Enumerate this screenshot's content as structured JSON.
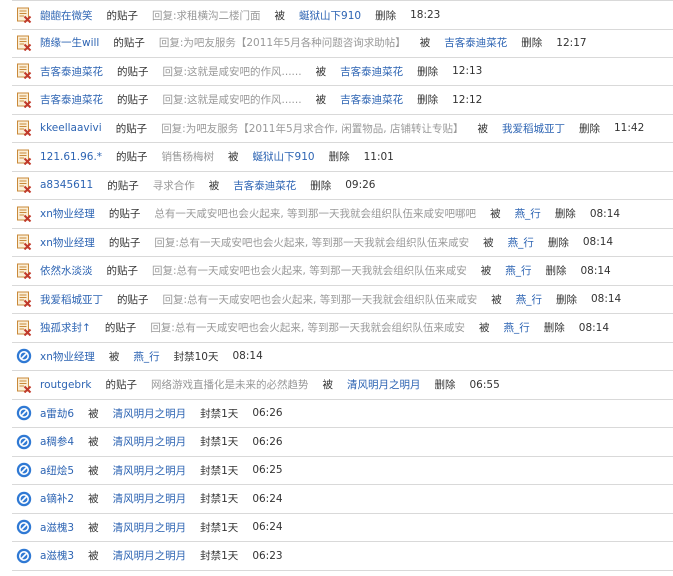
{
  "logs": [
    {
      "type": "post",
      "user": "龅龅在微笑",
      "label": "的贴子",
      "content": "回复:求租横沟二楼门面",
      "by": "被",
      "operator": "蜒狱山下910",
      "action": "删除",
      "time": "18:23"
    },
    {
      "type": "post",
      "user": "随缘一生will",
      "label": "的贴子",
      "content": "回复:为吧友服务【2011年5月各种问题咨询求助帖】",
      "by": "被",
      "operator": "吉客泰迪菜花",
      "action": "删除",
      "time": "12:17"
    },
    {
      "type": "post",
      "user": "吉客泰迪菜花",
      "label": "的贴子",
      "content": "回复:这就是咸安吧的作风......",
      "by": "被",
      "operator": "吉客泰迪菜花",
      "action": "删除",
      "time": "12:13"
    },
    {
      "type": "post",
      "user": "吉客泰迪菜花",
      "label": "的贴子",
      "content": "回复:这就是咸安吧的作风......",
      "by": "被",
      "operator": "吉客泰迪菜花",
      "action": "删除",
      "time": "12:12"
    },
    {
      "type": "post",
      "user": "kkeellaavivi",
      "label": "的贴子",
      "content": "回复:为吧友服务【2011年5月求合作, 闲置物品, 店铺转让专贴】",
      "by": "被",
      "operator": "我爱稻城亚丁",
      "action": "删除",
      "time": "11:42"
    },
    {
      "type": "post",
      "user": "121.61.96.*",
      "label": "的贴子",
      "content": "销售杨梅树",
      "by": "被",
      "operator": "蜒狱山下910",
      "action": "删除",
      "time": "11:01"
    },
    {
      "type": "post",
      "user": "a8345611",
      "label": "的贴子",
      "content": "寻求合作",
      "by": "被",
      "operator": "吉客泰迪菜花",
      "action": "删除",
      "time": "09:26"
    },
    {
      "type": "post",
      "user": "xn物业经理",
      "label": "的贴子",
      "content": "总有一天咸安吧也会火起来, 等到那一天我就会组织队伍来咸安吧哪吧",
      "by": "被",
      "operator": "燕_行",
      "action": "删除",
      "time": "08:14"
    },
    {
      "type": "post",
      "user": "xn物业经理",
      "label": "的贴子",
      "content": "回复:总有一天咸安吧也会火起来, 等到那一天我就会组织队伍来咸安",
      "by": "被",
      "operator": "燕_行",
      "action": "删除",
      "time": "08:14"
    },
    {
      "type": "post",
      "user": "依然水淡淡",
      "label": "的贴子",
      "content": "回复:总有一天咸安吧也会火起来, 等到那一天我就会组织队伍来咸安",
      "by": "被",
      "operator": "燕_行",
      "action": "删除",
      "time": "08:14"
    },
    {
      "type": "post",
      "user": "我爱稻城亚丁",
      "label": "的贴子",
      "content": "回复:总有一天咸安吧也会火起来, 等到那一天我就会组织队伍来咸安",
      "by": "被",
      "operator": "燕_行",
      "action": "删除",
      "time": "08:14"
    },
    {
      "type": "post",
      "user": "独孤求封↑",
      "label": "的贴子",
      "content": "回复:总有一天咸安吧也会火起来, 等到那一天我就会组织队伍来咸安",
      "by": "被",
      "operator": "燕_行",
      "action": "删除",
      "time": "08:14"
    },
    {
      "type": "ban",
      "user": "xn物业经理",
      "by": "被",
      "operator": "燕_行",
      "action": "封禁10天",
      "time": "08:14"
    },
    {
      "type": "post",
      "user": "routgebrk",
      "label": "的贴子",
      "content": "网络游戏直播化是未来的必然趋势",
      "by": "被",
      "operator": "清风明月之明月",
      "action": "删除",
      "time": "06:55"
    },
    {
      "type": "ban",
      "user": "a雷劫6",
      "by": "被",
      "operator": "清风明月之明月",
      "action": "封禁1天",
      "time": "06:26"
    },
    {
      "type": "ban",
      "user": "a稠参4",
      "by": "被",
      "operator": "清风明月之明月",
      "action": "封禁1天",
      "time": "06:26"
    },
    {
      "type": "ban",
      "user": "a纽烩5",
      "by": "被",
      "operator": "清风明月之明月",
      "action": "封禁1天",
      "time": "06:25"
    },
    {
      "type": "ban",
      "user": "a镝补2",
      "by": "被",
      "operator": "清风明月之明月",
      "action": "封禁1天",
      "time": "06:24"
    },
    {
      "type": "ban",
      "user": "a滋槐3",
      "by": "被",
      "operator": "清风明月之明月",
      "action": "封禁1天",
      "time": "06:24"
    },
    {
      "type": "ban",
      "user": "a滋槐3",
      "by": "被",
      "operator": "清风明月之明月",
      "action": "封禁1天",
      "time": "06:23"
    }
  ],
  "icons": {
    "post": "delete-post-icon",
    "ban": "ban-icon"
  },
  "colors": {
    "link": "#2d64b3",
    "muted": "#999999",
    "text": "#333333",
    "border": "#d9d9d9",
    "post_icon": "#c0392b",
    "ban_icon": "#2f79d4"
  }
}
